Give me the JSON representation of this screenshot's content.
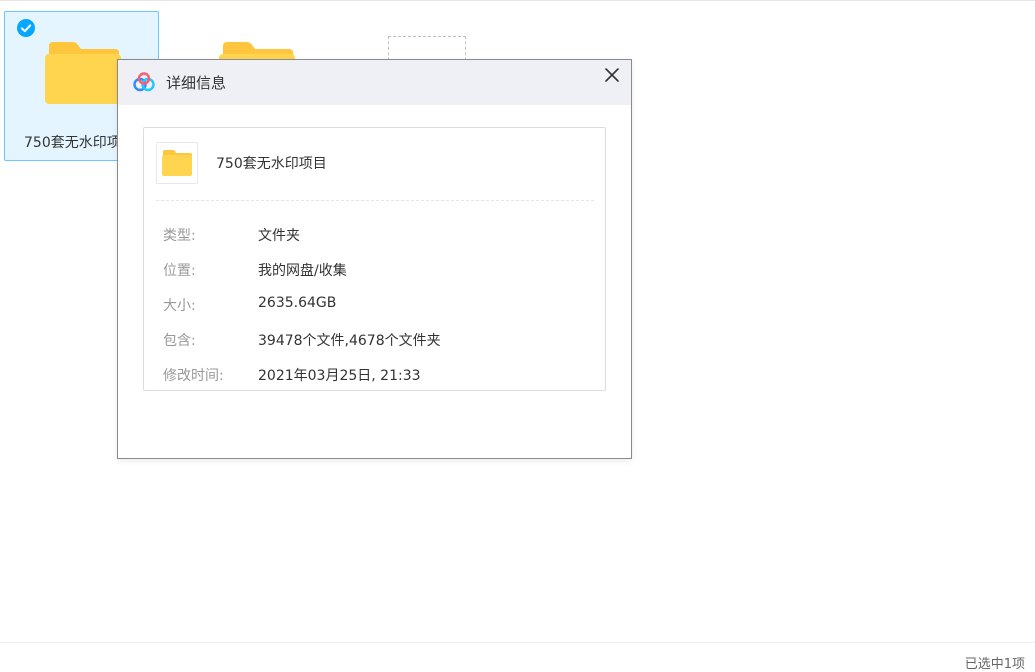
{
  "files": [
    {
      "name": "750套无水印项目",
      "selected": true
    },
    {
      "name": "",
      "selected": false
    }
  ],
  "dialog": {
    "title": "详细信息",
    "item_name": "750套无水印项目",
    "rows": [
      {
        "label": "类型:",
        "value": "文件夹"
      },
      {
        "label": "位置:",
        "value": "我的网盘/收集"
      },
      {
        "label": "大小:",
        "value": "2635.64GB"
      },
      {
        "label": "包含:",
        "value": "39478个文件,4678个文件夹"
      },
      {
        "label": "修改时间:",
        "value": "2021年03月25日, 21:33"
      }
    ]
  },
  "status": {
    "selection_text": "已选中1项"
  },
  "colors": {
    "accent": "#06a7ff",
    "folder": "#ffd54f",
    "selected_bg": "#e4f5ff"
  },
  "icons": {
    "check": "check-icon",
    "folder": "folder-icon",
    "logo": "baidu-netdisk-logo-icon",
    "close": "close-icon"
  }
}
